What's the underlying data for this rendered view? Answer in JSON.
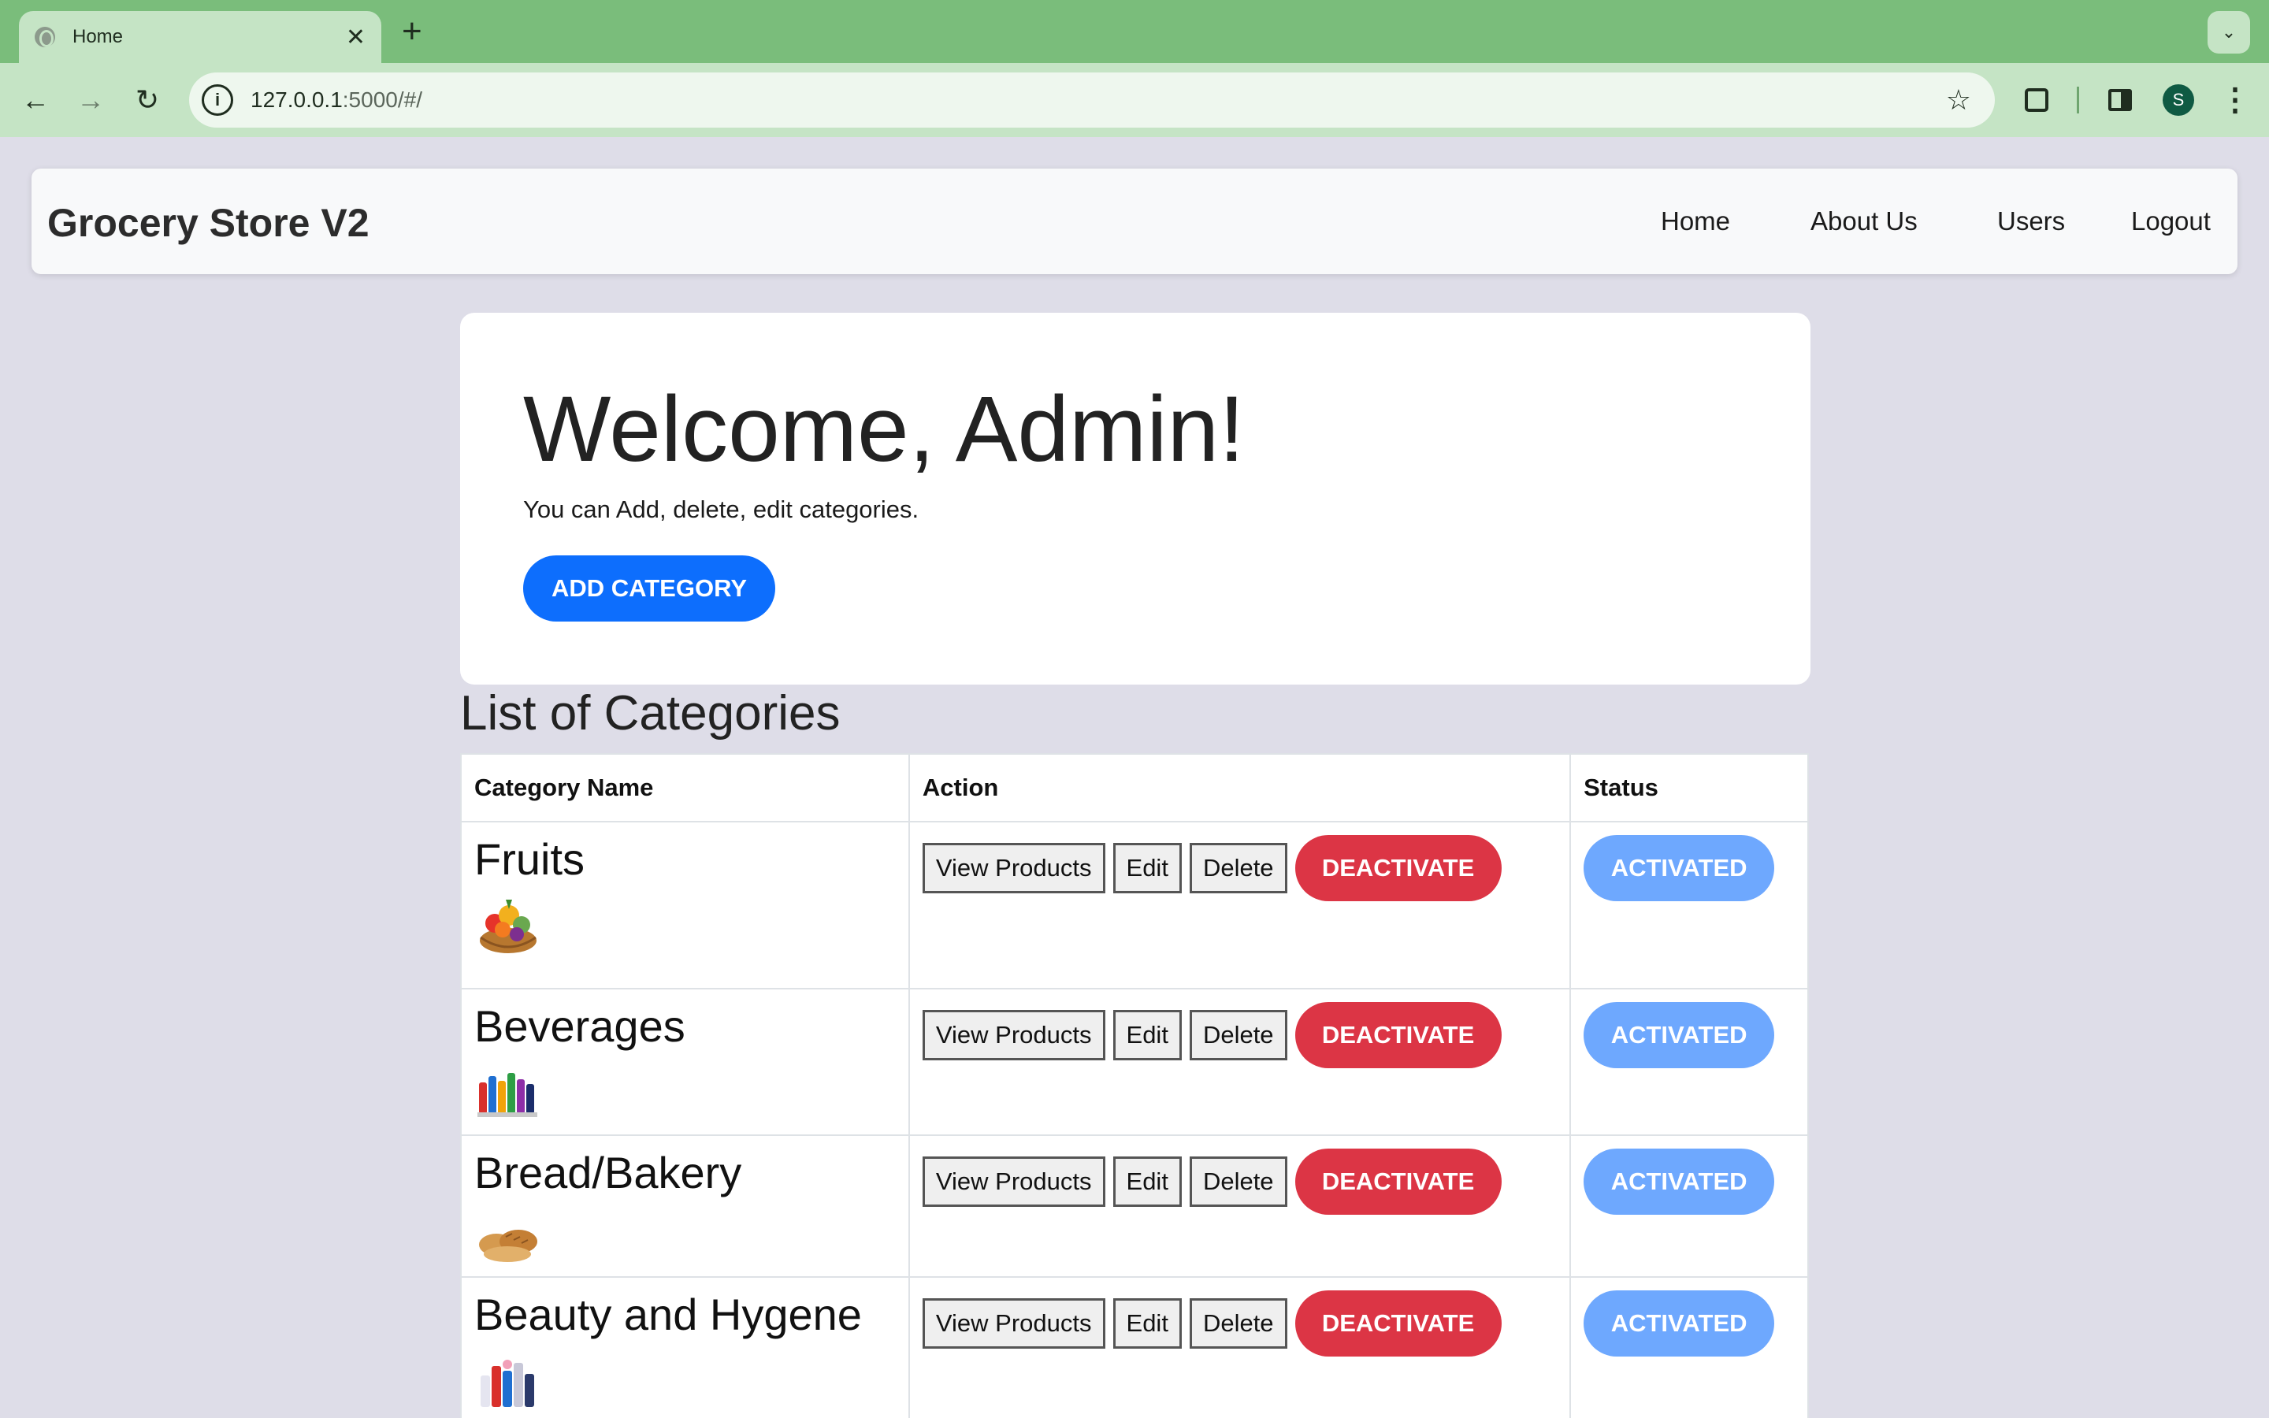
{
  "browser": {
    "tab_title": "Home",
    "tab_close": "✕",
    "new_tab": "+",
    "tab_menu": "⌄",
    "url_host": "127.0.0.1",
    "url_rest": ":5000/#/",
    "profile_initial": "S",
    "back": "←",
    "forward": "→",
    "reload": "↻",
    "info": "i",
    "star": "☆",
    "menu": "⋮"
  },
  "navbar": {
    "brand": "Grocery Store V2",
    "links": [
      "Home",
      "About Us",
      "Users",
      "Logout"
    ]
  },
  "welcome": {
    "title": "Welcome, Admin!",
    "subtitle": "You can Add, delete, edit categories.",
    "add_button": "ADD CATEGORY"
  },
  "categories": {
    "title": "List of Categories",
    "columns": [
      "Category Name",
      "Action",
      "Status"
    ],
    "action_labels": {
      "view": "View Products",
      "edit": "Edit",
      "delete": "Delete",
      "deactivate": "DEACTIVATE"
    },
    "rows": [
      {
        "name": "Fruits",
        "status": "ACTIVATED",
        "thumb": "fruit-basket"
      },
      {
        "name": "Beverages",
        "status": "ACTIVATED",
        "thumb": "bottles"
      },
      {
        "name": "Bread/Bakery",
        "status": "ACTIVATED",
        "thumb": "bread"
      },
      {
        "name": "Beauty and Hygene",
        "status": "ACTIVATED",
        "thumb": "toiletries"
      }
    ]
  },
  "colors": {
    "primary": "#0d6efd",
    "danger": "#dc3545",
    "status": "#6ea8fe",
    "browser_frame": "#7abd7b",
    "page_bg": "#dedde8"
  }
}
